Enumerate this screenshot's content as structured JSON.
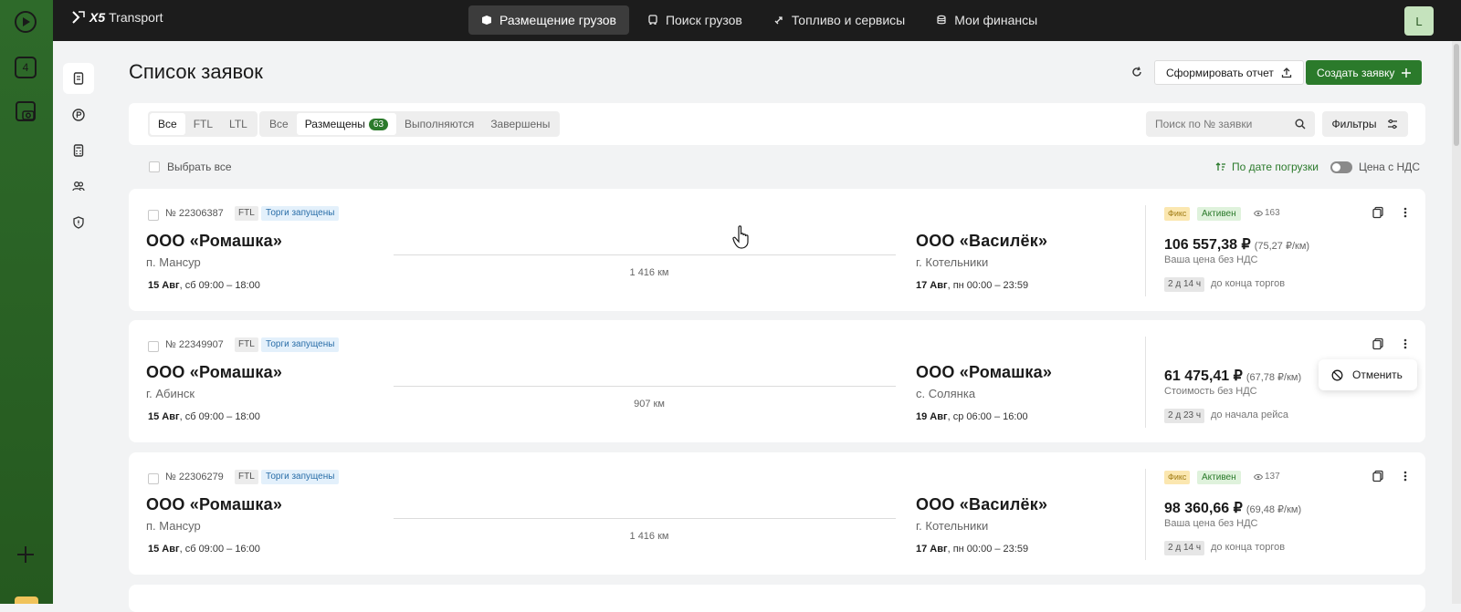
{
  "dock": {
    "badge": "4"
  },
  "brand": {
    "mark": "X5",
    "name": "Transport"
  },
  "nav": [
    {
      "label": "Размещение грузов",
      "active": true
    },
    {
      "label": "Поиск грузов"
    },
    {
      "label": "Топливо и сервисы"
    },
    {
      "label": "Мои финансы"
    }
  ],
  "user": {
    "initial": "L"
  },
  "page": {
    "title": "Список заявок",
    "report_label": "Сформировать отчет",
    "create_label": "Создать заявку"
  },
  "filters": {
    "type": [
      "Все",
      "FTL",
      "LTL"
    ],
    "status": [
      "Все",
      "Размещены",
      "Выполняются",
      "Завершены"
    ],
    "status_count": "63",
    "search_placeholder": "Поиск по № заявки",
    "filters_label": "Фильтры"
  },
  "list_controls": {
    "select_all": "Выбрать все",
    "sort_label": "По дате погрузки",
    "vat_label": "Цена с НДС"
  },
  "orders": [
    {
      "number": "№ 22306387",
      "type": "FTL",
      "auction": "Торги запущены",
      "from_company": "ООО «Ромашка»",
      "from_city": "п. Мансур",
      "from_date": "15 Авг",
      "from_time": ", сб 09:00 – 18:00",
      "distance": "1 416 км",
      "to_company": "ООО «Василёк»",
      "to_city": "г. Котельники",
      "to_date": "17 Авг",
      "to_time": ", пн 00:00 – 23:59",
      "fix": "Фикс",
      "status": "Активен",
      "views": "163",
      "price": "106 557,38 ₽",
      "price_km": "(75,27 ₽/км)",
      "price_note": "Ваша цена без НДС",
      "time": "2 д 14 ч",
      "time_note": "до конца торгов"
    },
    {
      "number": "№ 22349907",
      "type": "FTL",
      "auction": "Торги запущены",
      "from_company": "ООО «Ромашка»",
      "from_city": "г. Абинск",
      "from_date": "15 Авг",
      "from_time": ", сб 09:00 – 18:00",
      "distance": "907 км",
      "to_company": "ООО «Ромашка»",
      "to_city": "с. Солянка",
      "to_date": "19 Авг",
      "to_time": ", ср 06:00 – 16:00",
      "price": "61 475,41 ₽",
      "price_km": "(67,78 ₽/км)",
      "price_note": "Стоимость без НДС",
      "time": "2 д 23 ч",
      "time_note": "до начала рейса"
    },
    {
      "number": "№ 22306279",
      "type": "FTL",
      "auction": "Торги запущены",
      "from_company": "ООО «Ромашка»",
      "from_city": "п. Мансур",
      "from_date": "15 Авг",
      "from_time": ", сб 09:00 – 16:00",
      "distance": "1 416 км",
      "to_company": "ООО «Василёк»",
      "to_city": "г. Котельники",
      "to_date": "17 Авг",
      "to_time": ", пн 00:00 – 23:59",
      "fix": "Фикс",
      "status": "Активен",
      "views": "137",
      "price": "98 360,66 ₽",
      "price_km": "(69,48 ₽/км)",
      "price_note": "Ваша цена без НДС",
      "time": "2 д 14 ч",
      "time_note": "до конца торгов"
    }
  ],
  "context_menu": {
    "cancel_label": "Отменить"
  },
  "colors": {
    "accent": "#2b7a2b",
    "topbar": "#1c1c1c",
    "dock": "#2e6a2a"
  }
}
